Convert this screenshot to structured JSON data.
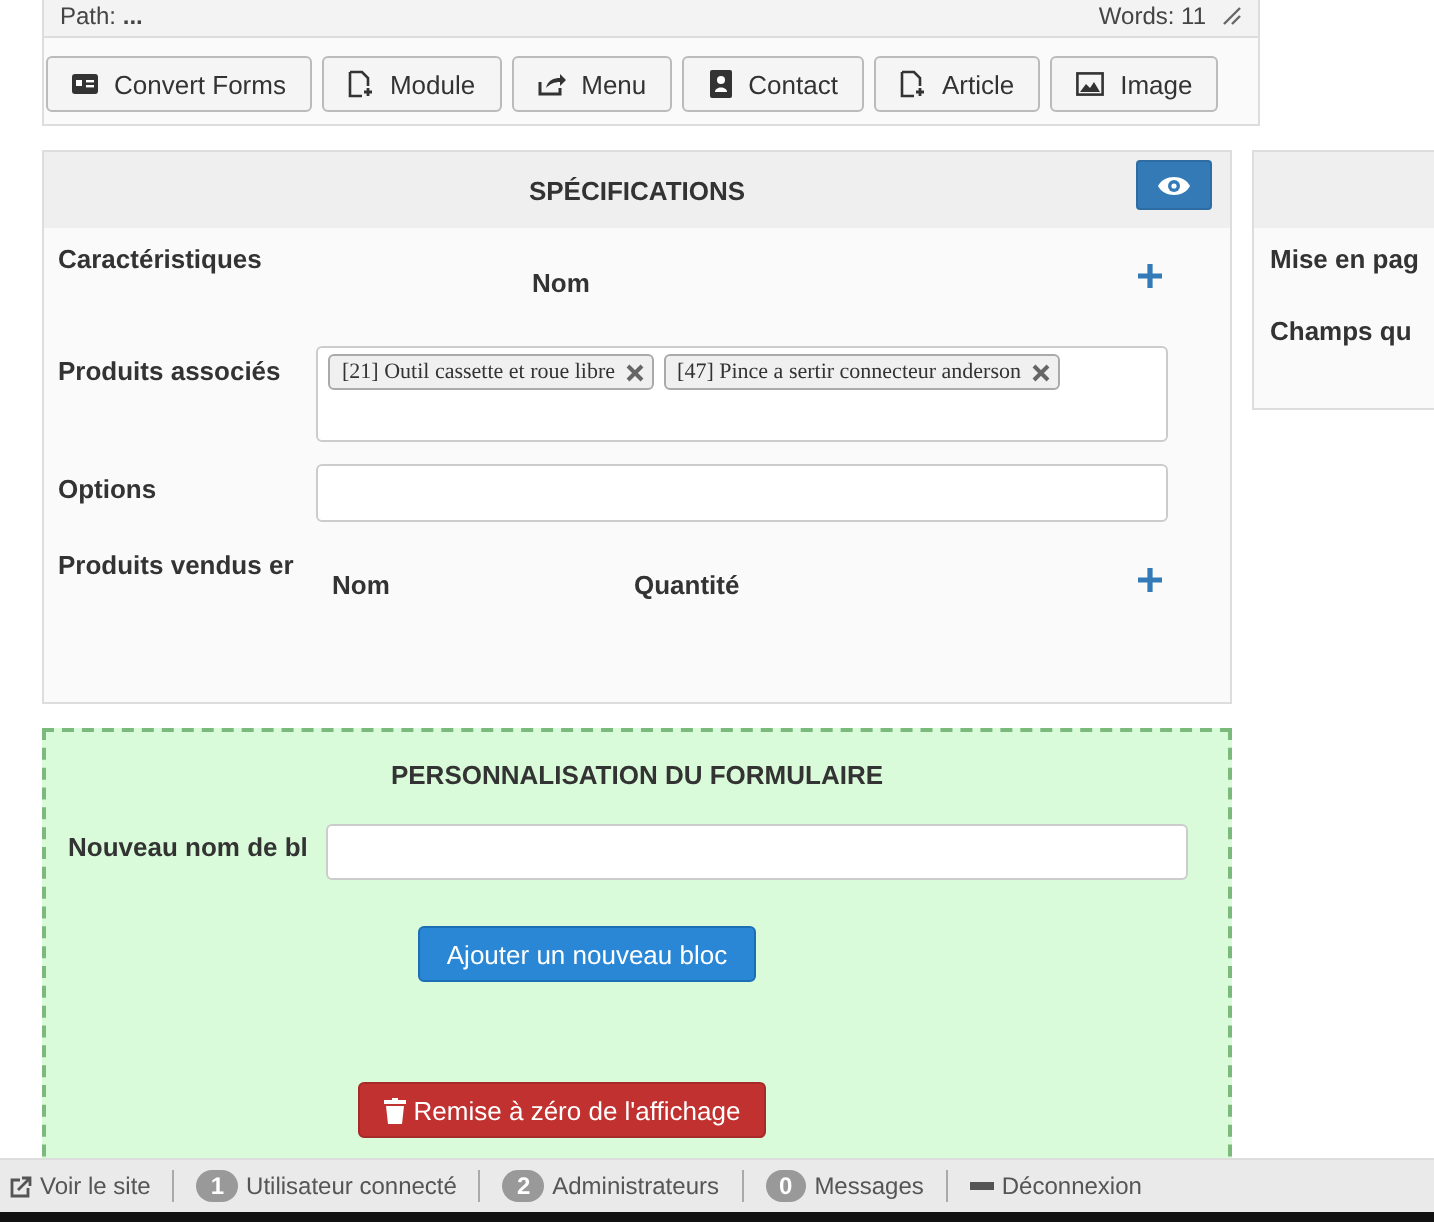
{
  "editor_footer": {
    "path_label": "Path:",
    "path": "...",
    "words": "Words: 11"
  },
  "toolbar_buttons": [
    {
      "label": "Convert Forms"
    },
    {
      "label": "Module"
    },
    {
      "label": "Menu"
    },
    {
      "label": "Contact"
    },
    {
      "label": "Article"
    },
    {
      "label": "Image"
    }
  ],
  "specifications": {
    "title": "SPÉCIFICATIONS",
    "caracteristiques": {
      "label": "Caractéristiques",
      "columns": [
        "Nom"
      ]
    },
    "produits_associes": {
      "label": "Produits associés",
      "tags": [
        "[21] Outil cassette et roue libre",
        "[47] Pince a sertir connecteur anderson"
      ]
    },
    "options": {
      "label": "Options"
    },
    "produits_vendus": {
      "label": "Produits vendus er",
      "columns": [
        "Nom",
        "Quantité"
      ]
    }
  },
  "side_panel": {
    "labels": [
      "Mise en pag",
      "Champs qu"
    ]
  },
  "customization": {
    "title": "PERSONNALISATION DU FORMULAIRE",
    "field_label": "Nouveau nom de bl",
    "add_button": "Ajouter un nouveau bloc",
    "reset_button": "Remise à zéro de l'affichage"
  },
  "status_bar": [
    {
      "kind": "link",
      "label": "Voir le site"
    },
    {
      "kind": "count",
      "count": "1",
      "label": "Utilisateur connecté"
    },
    {
      "kind": "count",
      "count": "2",
      "label": "Administrateurs"
    },
    {
      "kind": "count",
      "count": "0",
      "label": "Messages"
    },
    {
      "kind": "logout",
      "label": "Déconnexion"
    }
  ]
}
